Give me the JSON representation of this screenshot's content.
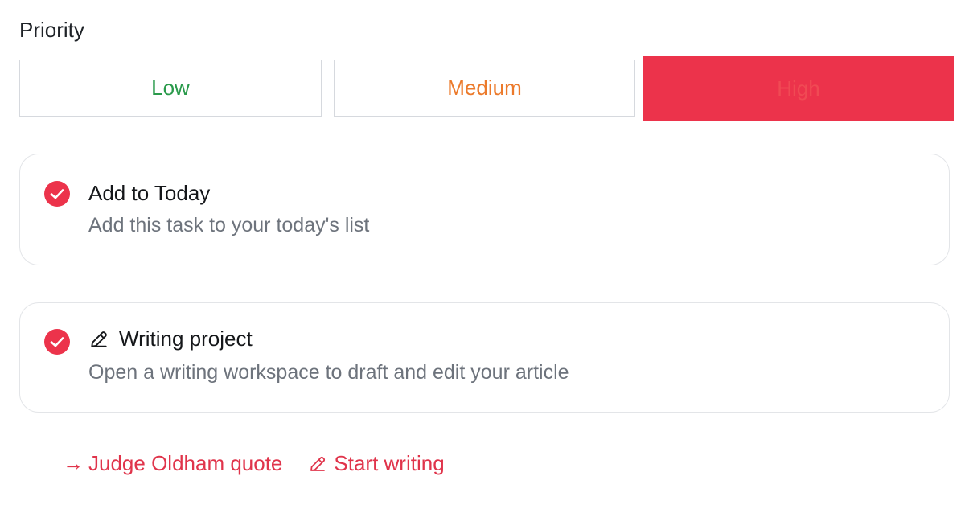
{
  "priority": {
    "label": "Priority",
    "options": [
      "Low",
      "Medium",
      "High"
    ],
    "selected": "High"
  },
  "options": {
    "today": {
      "title": "Add to Today",
      "description": "Add this task to your today's list",
      "checked": true
    },
    "writing": {
      "title": "Writing project",
      "description": "Open a writing workspace to draft and edit your article",
      "checked": true
    }
  },
  "links": {
    "quote_arrow": "→",
    "quote": "Judge Oldham quote",
    "start_writing": "Start writing"
  },
  "colors": {
    "accent": "#ec334b",
    "low": "#2a9a4b",
    "medium": "#ec7a2b",
    "link": "#e0344b"
  },
  "icons": [
    "check-circle-icon",
    "pencil-icon",
    "arrow-right-icon"
  ]
}
